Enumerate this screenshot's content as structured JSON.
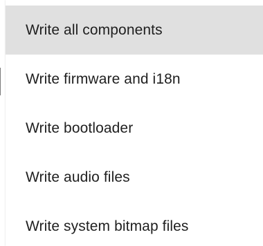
{
  "menu": {
    "highlighted_index": 0,
    "items": [
      {
        "label": "Write all components"
      },
      {
        "label": "Write firmware and i18n"
      },
      {
        "label": "Write bootloader"
      },
      {
        "label": "Write audio files"
      },
      {
        "label": "Write system bitmap files"
      }
    ]
  }
}
